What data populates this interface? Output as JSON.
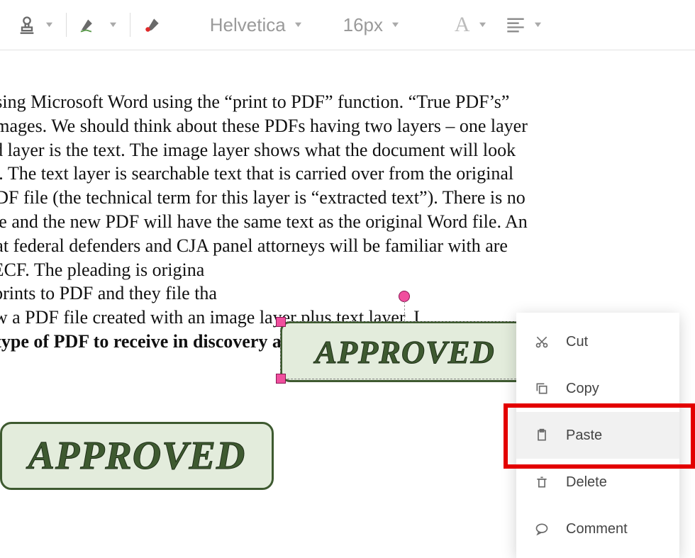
{
  "toolbar": {
    "font_name": "Helvetica",
    "font_size": "16px"
  },
  "document": {
    "line1": "ted using Microsoft Word using the “print to PDF” function. “True PDF’s”",
    "line2": "and images. We should think about these PDFs having two layers – one layer",
    "line3": "econd layer is the text. The image layer shows what the document will look",
    "line4": " paper. The text layer is searchable text that is carried over from the original",
    "line5": "ew PDF file (the technical term for this layer is “extracted text”). There is no",
    "line6": "chable and the new PDF will have the same text as the original Word file. An",
    "line7": "Fs that federal defenders and CJA panel attorneys will be familiar with are",
    "line8": " CM/ECF. The pleading is origina",
    "line9": "F or prints to PDF and they file tha",
    "line10": " is now a PDF file created with an image layer plus text layer. I",
    "bold_line": " best type of PDF to receive in discovery as it will have the "
  },
  "stamp": {
    "text": "APPROVED"
  },
  "menu": {
    "cut": "Cut",
    "copy": "Copy",
    "paste": "Paste",
    "delete": "Delete",
    "comment": "Comment"
  }
}
